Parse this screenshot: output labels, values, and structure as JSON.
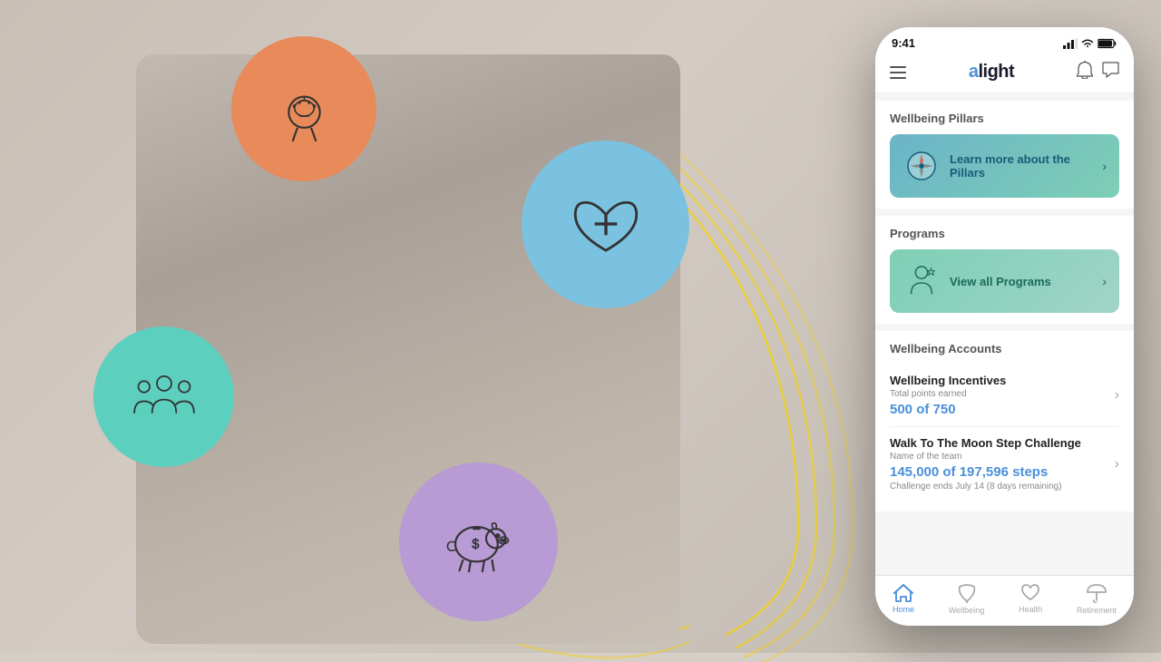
{
  "background": {
    "color": "#c8bfb5"
  },
  "circles": [
    {
      "id": "brain",
      "label": "Mental wellbeing",
      "color": "#e88a5a",
      "icon": "brain"
    },
    {
      "id": "health",
      "label": "Health",
      "color": "#7ac2e0",
      "icon": "heart-cross"
    },
    {
      "id": "people",
      "label": "Community",
      "color": "#5dcfbf",
      "icon": "people"
    },
    {
      "id": "piggy",
      "label": "Financial",
      "color": "#b89ad4",
      "icon": "piggy-bank"
    }
  ],
  "phone": {
    "status_bar": {
      "time": "9:41"
    },
    "header": {
      "logo": "alight",
      "menu_icon": "hamburger",
      "bell_icon": "bell",
      "chat_icon": "chat"
    },
    "sections": [
      {
        "id": "wellbeing-pillars",
        "title": "Wellbeing Pillars",
        "banner_text": "Learn more about the Pillars"
      },
      {
        "id": "programs",
        "title": "Programs",
        "banner_text": "View all Programs"
      },
      {
        "id": "wellbeing-accounts",
        "title": "Wellbeing Accounts",
        "accounts": [
          {
            "id": "wellbeing-incentives",
            "name": "Wellbeing Incentives",
            "sub_label": "Total points earned",
            "value": "500 of 750"
          },
          {
            "id": "step-challenge",
            "name": "Walk To The Moon Step Challenge",
            "sub_label": "Name of the team",
            "value": "145,000 of 197,596 steps",
            "detail": "Challenge ends July 14 (8 days remaining)"
          }
        ]
      }
    ],
    "bottom_nav": [
      {
        "id": "home",
        "label": "Home",
        "icon": "home",
        "active": true
      },
      {
        "id": "wellbeing",
        "label": "Wellbeing",
        "icon": "leaf",
        "active": false
      },
      {
        "id": "health",
        "label": "Health",
        "icon": "heart",
        "active": false
      },
      {
        "id": "retirement",
        "label": "Retirement",
        "icon": "umbrella",
        "active": false
      }
    ]
  }
}
